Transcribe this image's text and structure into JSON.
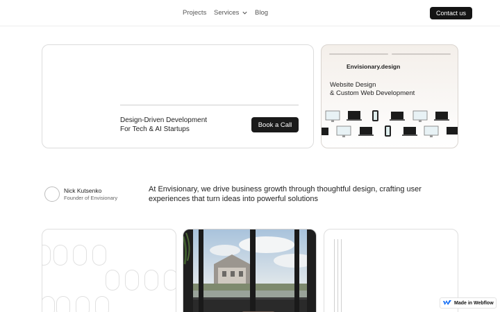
{
  "nav": {
    "projects": "Projects",
    "services": "Services",
    "blog": "Blog",
    "contact": "Contact us"
  },
  "hero": {
    "tagline_line1": "Design-Driven Development",
    "tagline_line2": "For Tech & AI Startups",
    "cta": "Book a Call"
  },
  "promo": {
    "brand": "Envisionary.design",
    "title_line1": "Website Design",
    "title_line2": "& Custom Web Development"
  },
  "founder": {
    "name": "Nick Kutsenko",
    "role": "Founder of Envisionary"
  },
  "statement": {
    "text": "At Envisionary, we drive business growth through thoughtful design, crafting user experiences that turn ideas into powerful solutions"
  },
  "badge": {
    "label": "Made in Webflow"
  },
  "colors": {
    "dark_button": "#141414",
    "promo_bg": "#f4efea",
    "webflow_blue": "#146ef5"
  },
  "icons": {
    "services_dropdown": "chevron-down-icon",
    "webflow": "webflow-logo-icon"
  }
}
